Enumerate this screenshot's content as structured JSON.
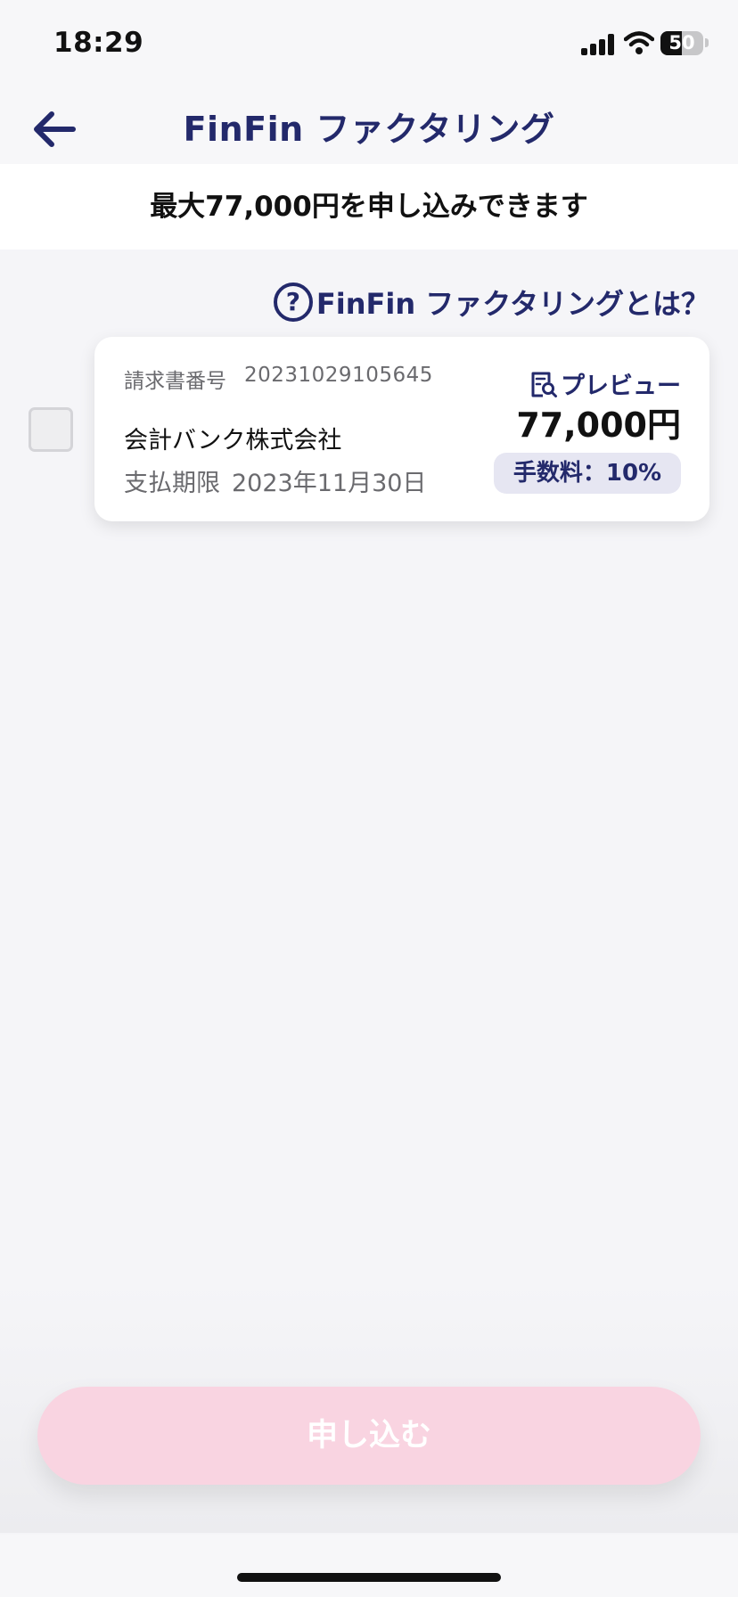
{
  "status_bar": {
    "time": "18:29",
    "battery_level": "50",
    "icons": [
      "cellular-signal-icon",
      "wifi-icon",
      "battery-icon"
    ]
  },
  "nav": {
    "back_icon": "arrow-left-icon",
    "title": "FinFin ファクタリング"
  },
  "limit_banner": "最大77,000円を申し込みできます",
  "help_link": {
    "icon": "question-circle-icon",
    "icon_glyph": "?",
    "label": "FinFin ファクタリングとは？"
  },
  "invoice": {
    "selected": false,
    "number_label": "請求書番号",
    "number": "20231029105645",
    "company": "会計バンク株式会社",
    "due_label": "支払期限",
    "due_date": "2023年11月30日",
    "preview_icon": "document-search-icon",
    "preview_label": "プレビュー",
    "amount": "77,000円",
    "fee": "手数料：10%"
  },
  "apply_button": "申し込む",
  "colors": {
    "accent": "#23296b",
    "background": "#f5f5f8",
    "button_disabled": "#f9d4e1",
    "fee_badge": "#e6e6f2"
  }
}
